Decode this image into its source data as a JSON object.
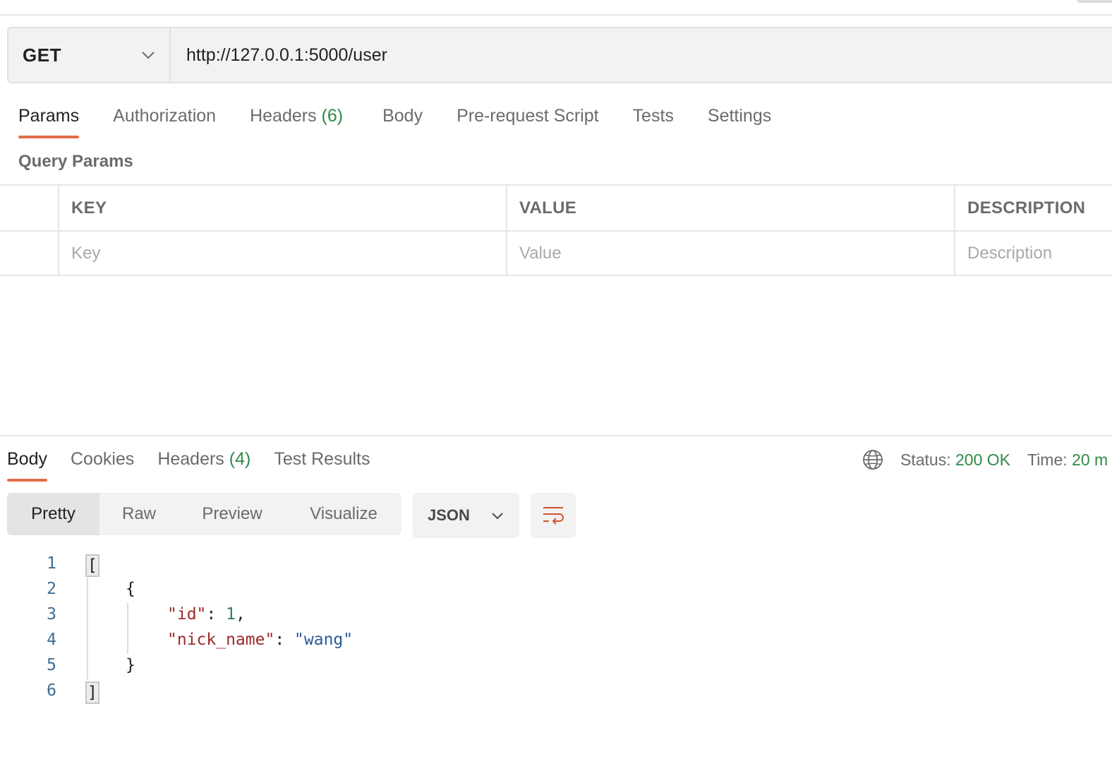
{
  "request": {
    "method": "GET",
    "url": "http://127.0.0.1:5000/user"
  },
  "request_tabs": [
    {
      "label": "Params",
      "count": ""
    },
    {
      "label": "Authorization",
      "count": ""
    },
    {
      "label": "Headers",
      "count": "(6)"
    },
    {
      "label": "Body",
      "count": ""
    },
    {
      "label": "Pre-request Script",
      "count": ""
    },
    {
      "label": "Tests",
      "count": ""
    },
    {
      "label": "Settings",
      "count": ""
    }
  ],
  "query_params": {
    "title": "Query Params",
    "headers": [
      "KEY",
      "VALUE",
      "DESCRIPTION"
    ],
    "placeholders": [
      "Key",
      "Value",
      "Description"
    ]
  },
  "response_tabs": [
    {
      "label": "Body",
      "count": ""
    },
    {
      "label": "Cookies",
      "count": ""
    },
    {
      "label": "Headers",
      "count": "(4)"
    },
    {
      "label": "Test Results",
      "count": ""
    }
  ],
  "status": {
    "status_label": "Status:",
    "status_value": "200 OK",
    "time_label": "Time:",
    "time_value": "20 m"
  },
  "format": {
    "views": [
      "Pretty",
      "Raw",
      "Preview",
      "Visualize"
    ],
    "language": "JSON"
  },
  "code": {
    "line_numbers": [
      "1",
      "2",
      "3",
      "4",
      "5",
      "6"
    ],
    "open_bracket": "[",
    "open_brace": "{",
    "key_id": "\"id\"",
    "colon": ": ",
    "value_id": "1",
    "comma": ",",
    "key_nick": "\"nick_name\"",
    "value_nick": "\"wang\"",
    "close_brace": "}",
    "close_bracket": "]"
  },
  "colors": {
    "accent": "#e26d47",
    "success": "#2f8a47"
  },
  "icons": [
    "chevron-down-icon",
    "globe-icon",
    "wrap-lines-icon"
  ]
}
